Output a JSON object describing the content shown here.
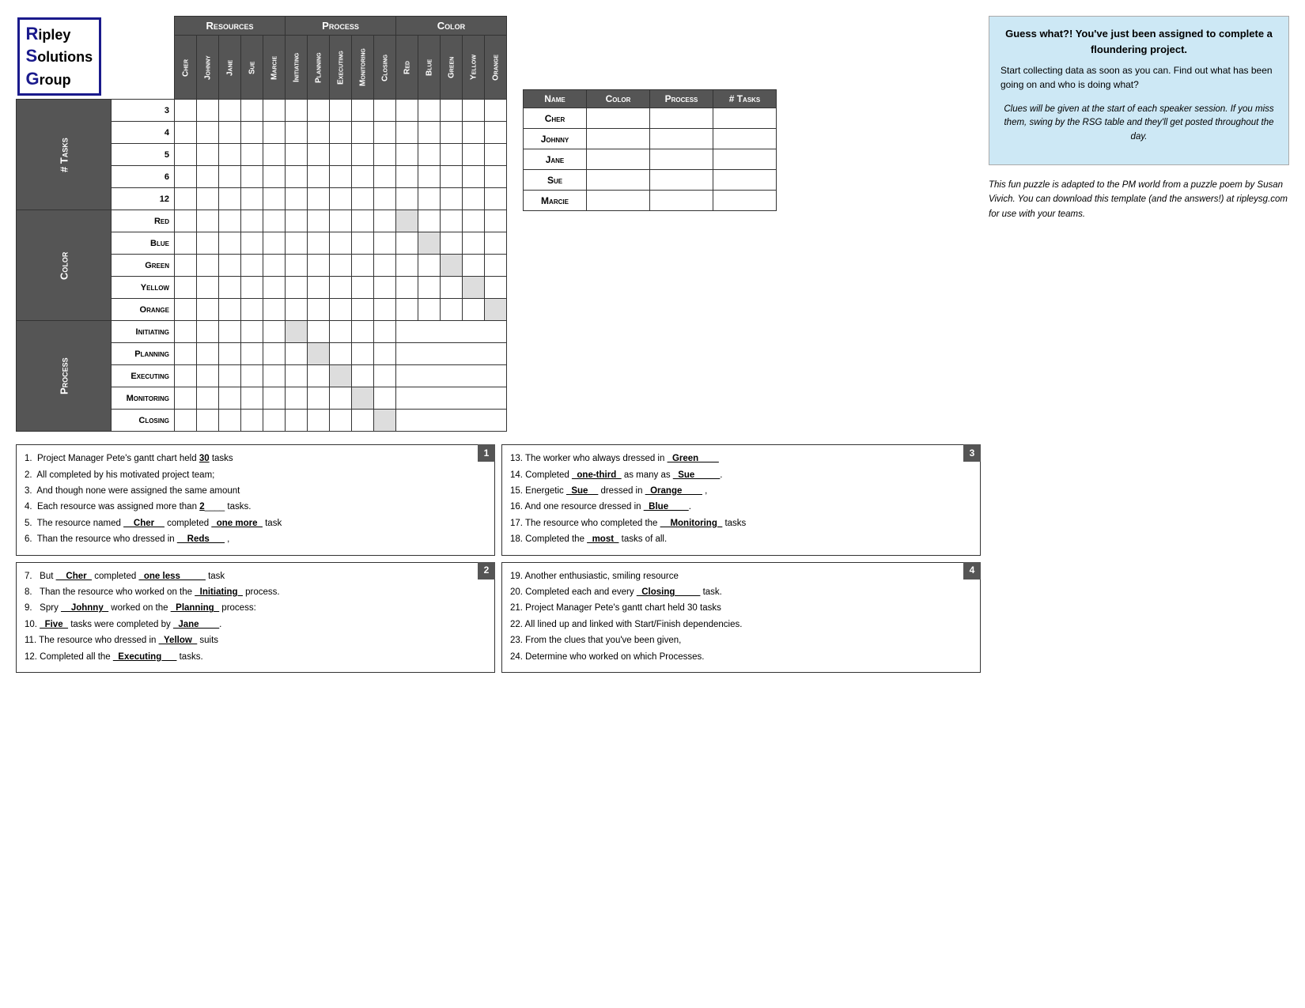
{
  "logo": {
    "line1": "ipley",
    "line2": "olutions",
    "line3": "roup"
  },
  "grid": {
    "resources_header": "Resources",
    "process_header": "Process",
    "color_header": "Color",
    "col_headers": [
      "Cher",
      "Johnny",
      "Jane",
      "Sue",
      "Marcie",
      "Initiating",
      "Planning",
      "Executing",
      "Monitoring",
      "Closing",
      "Red",
      "Blue",
      "Green",
      "Yellow",
      "Orange"
    ],
    "row_sections": [
      {
        "label": "# Tasks",
        "rows": [
          "3",
          "4",
          "5",
          "6",
          "12"
        ]
      },
      {
        "label": "Color",
        "rows": [
          "Red",
          "Blue",
          "Green",
          "Yellow",
          "Orange"
        ]
      },
      {
        "label": "Process",
        "rows": [
          "Initiating",
          "Planning",
          "Executing",
          "Monitoring",
          "Closing"
        ]
      }
    ]
  },
  "answer_table": {
    "headers": [
      "Name",
      "Color",
      "Process",
      "# Tasks"
    ],
    "rows": [
      {
        "name": "Cher",
        "color": "",
        "process": "",
        "tasks": ""
      },
      {
        "name": "Johnny",
        "color": "",
        "process": "",
        "tasks": ""
      },
      {
        "name": "Jane",
        "color": "",
        "process": "",
        "tasks": ""
      },
      {
        "name": "Sue",
        "color": "",
        "process": "",
        "tasks": ""
      },
      {
        "name": "Marcie",
        "color": "",
        "process": "",
        "tasks": ""
      }
    ]
  },
  "info_box": {
    "headline": "Guess what?! You've just been assigned to complete a floundering project.",
    "body1": "Start collecting data as soon as you can.  Find out what has been going on and who is doing what?",
    "body2": "Clues will be given at the start of each speaker session.  If you miss them, swing by the RSG table and they'll get posted throughout the day.",
    "body3": "This fun puzzle is adapted to the PM world from a puzzle poem by Susan Vivich.  You can download this template (and the answers!) at ripleysg.com for use with your teams."
  },
  "clue_boxes": [
    {
      "number": "1",
      "lines": [
        "1.  Project Manager Pete’s gantt chart held __30__ tasks",
        "2.  All completed by his motivated project team;",
        "3.  And though none were assigned the same amount",
        "4.  Each resource was assigned more than __2____ tasks.",
        "5.  The resource named __Cher__ completed _one more_ task",
        "6.  Than the resource who dressed in __Reds___ ,"
      ]
    },
    {
      "number": "2",
      "lines": [
        "7.  But __Cher_ completed _one less_____ task",
        "8.  Than the resource who worked on the _Initiating_ process.",
        "9.  Spry __Johnny_ worked on the _Planning_ process:",
        "10. _Five_ tasks were completed by _Jane____.",
        "11. The resource who dressed in _Yellow_ suits",
        "12. Completed all the _Executing___ tasks."
      ]
    },
    {
      "number": "3",
      "lines": [
        "13. The worker who always dressed in _Green____",
        "14. Completed _one-third_ as many as _Sue_____.",
        "15. Energetic _Sue__ dressed in _Orange____ ,",
        "16. And one resource dressed in _Blue____.",
        "17. The resource who completed the __Monitoring_ tasks",
        "18. Completed the _most_ tasks of all."
      ]
    },
    {
      "number": "4",
      "lines": [
        "19. Another enthusiastic, smiling resource",
        "20. Completed each and every _Closing_____ task.",
        "21. Project Manager Pete’s gantt chart held 30 tasks",
        "22. All lined up and linked with Start/Finish dependencies.",
        "23. From the clues that you’ve been given,",
        "24. Determine who worked on which Processes."
      ]
    }
  ]
}
